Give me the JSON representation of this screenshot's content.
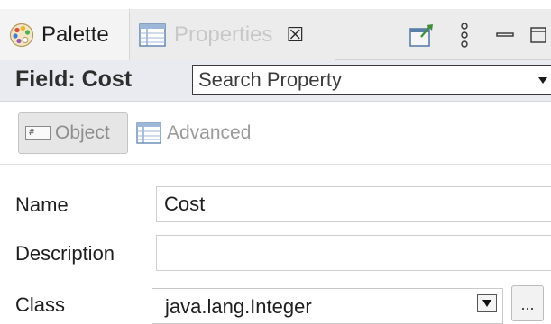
{
  "tabs": [
    {
      "label": "Palette",
      "icon": "palette-icon",
      "active": true
    },
    {
      "label": "Properties",
      "icon": "properties-icon",
      "active": false
    }
  ],
  "tab_close_glyph": "☒",
  "toolbar": {
    "icons": [
      "pin-view-icon",
      "view-menu-icon",
      "minimize-icon",
      "maximize-icon"
    ]
  },
  "header": {
    "title": "Field: Cost",
    "search_placeholder": "Search Property"
  },
  "subtabs": [
    {
      "label": "Object",
      "icon": "object-icon",
      "selected": true
    },
    {
      "label": "Advanced",
      "icon": "advanced-icon",
      "selected": false
    }
  ],
  "form": {
    "name": {
      "label": "Name",
      "value": "Cost"
    },
    "description": {
      "label": "Description",
      "value": ""
    },
    "class": {
      "label": "Class",
      "value": "java.lang.Integer",
      "browse_label": "..."
    }
  },
  "colors": {
    "tabbar_bg": "#ececec",
    "header_bg": "#e9ebf0",
    "inactive_text": "#c8c8c8"
  }
}
